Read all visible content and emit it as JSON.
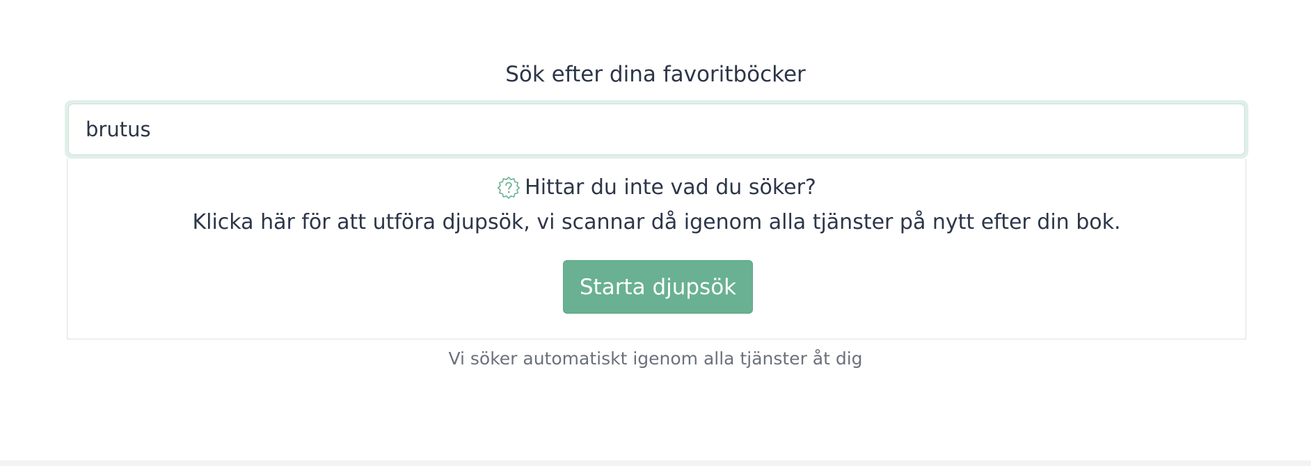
{
  "search": {
    "heading": "Sök efter dina favoritböcker",
    "value": "brutus"
  },
  "deep_search": {
    "icon": "help-badge-icon",
    "title": "Hittar du inte vad du söker?",
    "description": "Klicka här för att utföra djupsök, vi scannar då igenom alla tjänster på nytt efter din bok.",
    "button_label": "Starta djupsök"
  },
  "note": "Vi söker automatiskt igenom alla tjänster åt dig",
  "colors": {
    "accent": "#69b192",
    "text": "#2d3648",
    "muted": "#6b717c",
    "focus_ring": "#e1efe9"
  }
}
